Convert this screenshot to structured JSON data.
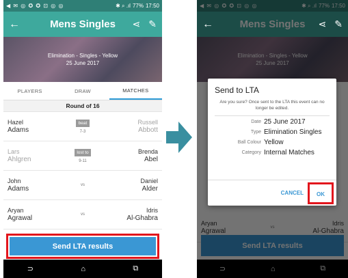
{
  "status_bar": {
    "icons_left": "◀ ✉ ◎ ✪ ✪ ⊡ ◎ ◎",
    "icons_right": "✱ ⌕ .ıl",
    "battery": "77%",
    "time": "17:50"
  },
  "app_bar": {
    "title": "Mens Singles",
    "back_icon": "arrow-left-icon",
    "share_icon": "share-icon",
    "edit_icon": "pencil-icon"
  },
  "banner": {
    "line1": "Elimination - Singles - Yellow",
    "line2": "25 June 2017"
  },
  "tabs": [
    {
      "label": "PLAYERS"
    },
    {
      "label": "DRAW"
    },
    {
      "label": "MATCHES",
      "active": true
    }
  ],
  "round": {
    "label": "Round of 16"
  },
  "matches": [
    {
      "left_first": "Hazel",
      "left_last": "Adams",
      "result": "beat",
      "score": "7-3",
      "right_first": "Russell",
      "right_last": "Abbott"
    },
    {
      "left_first": "Lars",
      "left_last": "Ahlgren",
      "result": "lost to",
      "score": "9-11",
      "right_first": "Brenda",
      "right_last": "Abel"
    },
    {
      "left_first": "John",
      "left_last": "Adams",
      "result": "vs",
      "score": "",
      "right_first": "Daniel",
      "right_last": "Alder"
    },
    {
      "left_first": "Aryan",
      "left_last": "Agrawal",
      "result": "vs",
      "score": "",
      "right_first": "Idris",
      "right_last": "Al-Ghabra"
    }
  ],
  "send_button": {
    "label": "Send LTA results"
  },
  "nav": {
    "back": "⊃",
    "home": "⌂",
    "recent": "⧉"
  },
  "dialog": {
    "title": "Send to LTA",
    "message": "Are you sure? Once sent to the LTA this event can no longer be edited.",
    "rows": [
      {
        "key": "Date",
        "value": "25 June 2017"
      },
      {
        "key": "Type",
        "value": "Elimination Singles"
      },
      {
        "key": "Ball Colour",
        "value": "Yellow"
      },
      {
        "key": "Category",
        "value": "Internal Matches"
      }
    ],
    "cancel": "CANCEL",
    "ok": "OK"
  },
  "colors": {
    "teal": "#3ea99d",
    "blue": "#3a97d4",
    "highlight": "#e2151c"
  }
}
